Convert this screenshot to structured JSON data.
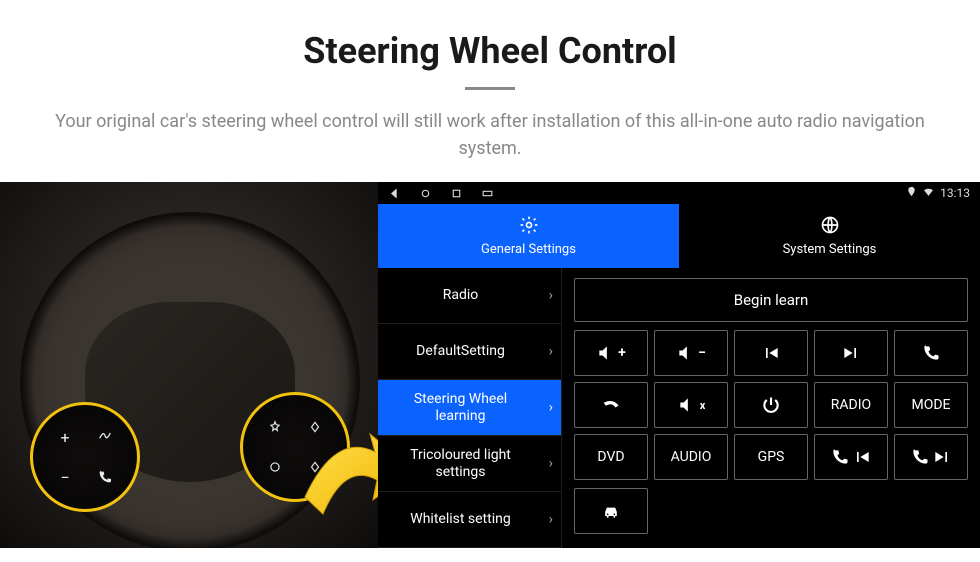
{
  "header": {
    "title": "Steering Wheel Control",
    "subtitle": "Your original car's steering wheel control will still work after installation of this all-in-one auto radio navigation system."
  },
  "status_bar": {
    "time": "13:13",
    "icons": {
      "gps": "gps-icon",
      "wifi": "wifi-icon"
    },
    "nav": {
      "back": "◁",
      "home": "○",
      "recents": "□",
      "extra": "▭"
    }
  },
  "tabs": [
    {
      "id": "general",
      "label": "General Settings",
      "icon": "gear-icon",
      "active": true
    },
    {
      "id": "system",
      "label": "System Settings",
      "icon": "globe-icon",
      "active": false
    }
  ],
  "menu": [
    {
      "id": "radio",
      "label": "Radio",
      "active": false
    },
    {
      "id": "default",
      "label": "DefaultSetting",
      "active": false
    },
    {
      "id": "swc",
      "label": "Steering Wheel learning",
      "active": true
    },
    {
      "id": "tricolour",
      "label": "Tricoloured light settings",
      "active": false
    },
    {
      "id": "whitelist",
      "label": "Whitelist setting",
      "active": false
    }
  ],
  "panel": {
    "begin_label": "Begin learn",
    "buttons": [
      {
        "id": "vol-up",
        "kind": "icon",
        "icon": "volume-up-icon",
        "label": ""
      },
      {
        "id": "vol-down",
        "kind": "icon",
        "icon": "volume-down-icon",
        "label": ""
      },
      {
        "id": "prev",
        "kind": "icon",
        "icon": "prev-track-icon",
        "label": ""
      },
      {
        "id": "next",
        "kind": "icon",
        "icon": "next-track-icon",
        "label": ""
      },
      {
        "id": "call",
        "kind": "icon",
        "icon": "phone-icon",
        "label": ""
      },
      {
        "id": "hangup",
        "kind": "icon",
        "icon": "hangup-icon",
        "label": ""
      },
      {
        "id": "mute",
        "kind": "icon",
        "icon": "mute-icon",
        "label": ""
      },
      {
        "id": "power",
        "kind": "icon",
        "icon": "power-icon",
        "label": ""
      },
      {
        "id": "radio-btn",
        "kind": "text",
        "icon": "",
        "label": "RADIO"
      },
      {
        "id": "mode",
        "kind": "text",
        "icon": "",
        "label": "MODE"
      },
      {
        "id": "dvd",
        "kind": "text",
        "icon": "",
        "label": "DVD"
      },
      {
        "id": "audio",
        "kind": "text",
        "icon": "",
        "label": "AUDIO"
      },
      {
        "id": "gps",
        "kind": "text",
        "icon": "",
        "label": "GPS"
      },
      {
        "id": "call-prev",
        "kind": "icon",
        "icon": "phone-prev-icon",
        "label": ""
      },
      {
        "id": "call-next",
        "kind": "icon",
        "icon": "phone-next-icon",
        "label": ""
      }
    ],
    "extra_button": {
      "id": "car",
      "icon": "car-icon"
    }
  },
  "wheel": {
    "left_buttons": [
      "+",
      "voice",
      "−",
      "phone"
    ],
    "right_buttons": [
      "star",
      "diamond",
      "circle",
      "diamond2"
    ]
  }
}
